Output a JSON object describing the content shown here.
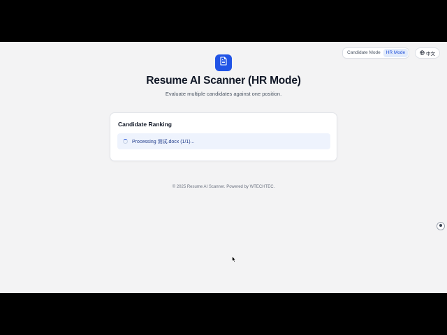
{
  "header": {
    "mode_toggle": {
      "candidate_mode": "Candidate Mode",
      "hr_mode": "HR Mode",
      "active": "HR Mode"
    },
    "language": {
      "label": "中文",
      "icon": "globe-icon"
    }
  },
  "hero": {
    "logo_icon": "document-icon",
    "title": "Resume AI Scanner (HR Mode)",
    "subtitle": "Evaluate multiple candidates against one position."
  },
  "ranking_card": {
    "title": "Candidate Ranking",
    "status": "Processing 测试.docx (1/1)...",
    "status_icon": "spinner-icon"
  },
  "footer": {
    "text": "© 2025 Resume AI Scanner. Powered by WTECHTEC."
  },
  "colors": {
    "accent": "#2154e6",
    "status_bg": "#eef3fd",
    "status_text": "#1e3a8a"
  }
}
